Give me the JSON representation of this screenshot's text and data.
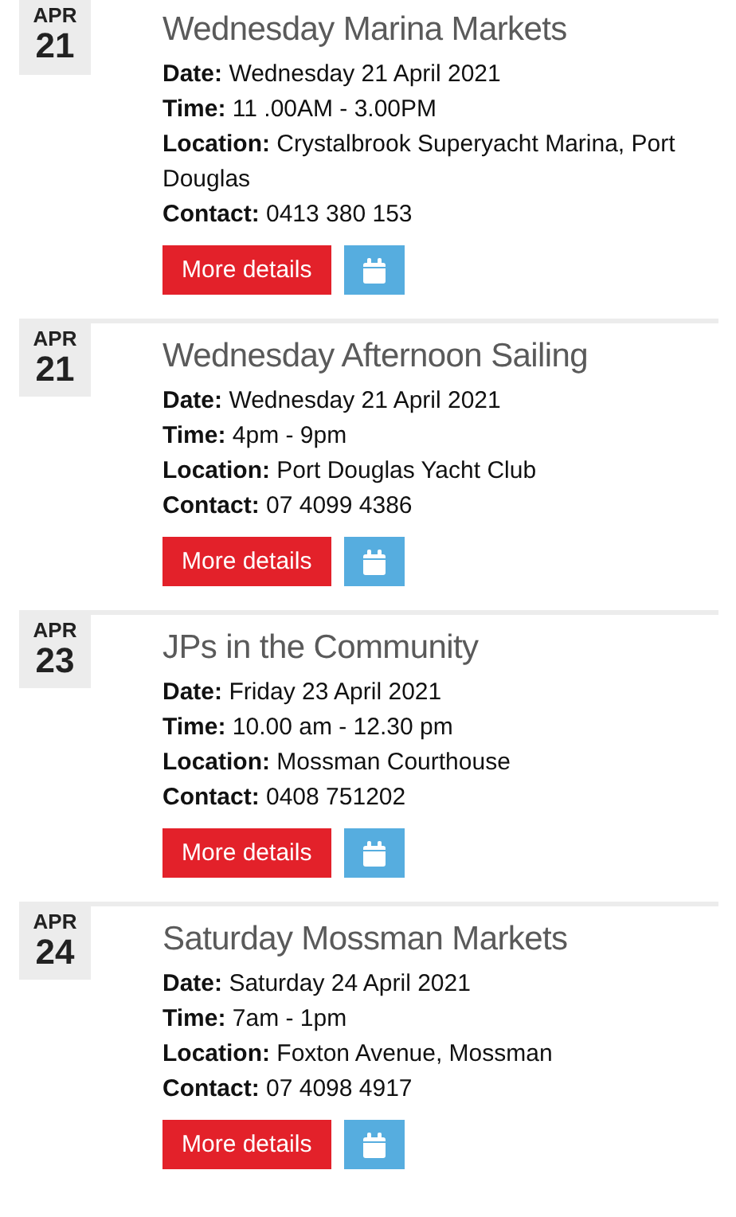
{
  "events": [
    {
      "month": "APR",
      "day": "21",
      "title": "Wednesday Marina Markets",
      "fields": [
        {
          "label": "Date:",
          "value": "Wednesday 21 April 2021"
        },
        {
          "label": "Time:",
          "value": "11 .00AM - 3.00PM"
        },
        {
          "label": "Location:",
          "value": "Crystalbrook Superyacht Marina, Port Douglas"
        },
        {
          "label": "Contact:",
          "value": "0413 380 153"
        }
      ],
      "button": "More details"
    },
    {
      "month": "APR",
      "day": "21",
      "title": "Wednesday Afternoon Sailing",
      "fields": [
        {
          "label": "Date:",
          "value": "Wednesday 21 April 2021"
        },
        {
          "label": "Time:",
          "value": "4pm - 9pm"
        },
        {
          "label": "Location:",
          "value": "Port Douglas Yacht Club"
        },
        {
          "label": "Contact:",
          "value": "07 4099 4386"
        }
      ],
      "button": "More details"
    },
    {
      "month": "APR",
      "day": "23",
      "title": "JPs in the Community",
      "fields": [
        {
          "label": "Date:",
          "value": "Friday 23 April 2021"
        },
        {
          "label": "Time:",
          "value": "10.00 am - 12.30 pm"
        },
        {
          "label": "Location:",
          "value": "Mossman Courthouse"
        },
        {
          "label": "Contact:",
          "value": "0408 751202"
        }
      ],
      "button": "More details"
    },
    {
      "month": "APR",
      "day": "24",
      "title": "Saturday Mossman Markets",
      "fields": [
        {
          "label": "Date:",
          "value": "Saturday 24 April 2021"
        },
        {
          "label": "Time:",
          "value": "7am - 1pm"
        },
        {
          "label": "Location:",
          "value": "Foxton Avenue, Mossman"
        },
        {
          "label": "Contact:",
          "value": "07 4098 4917"
        }
      ],
      "button": "More details"
    }
  ]
}
